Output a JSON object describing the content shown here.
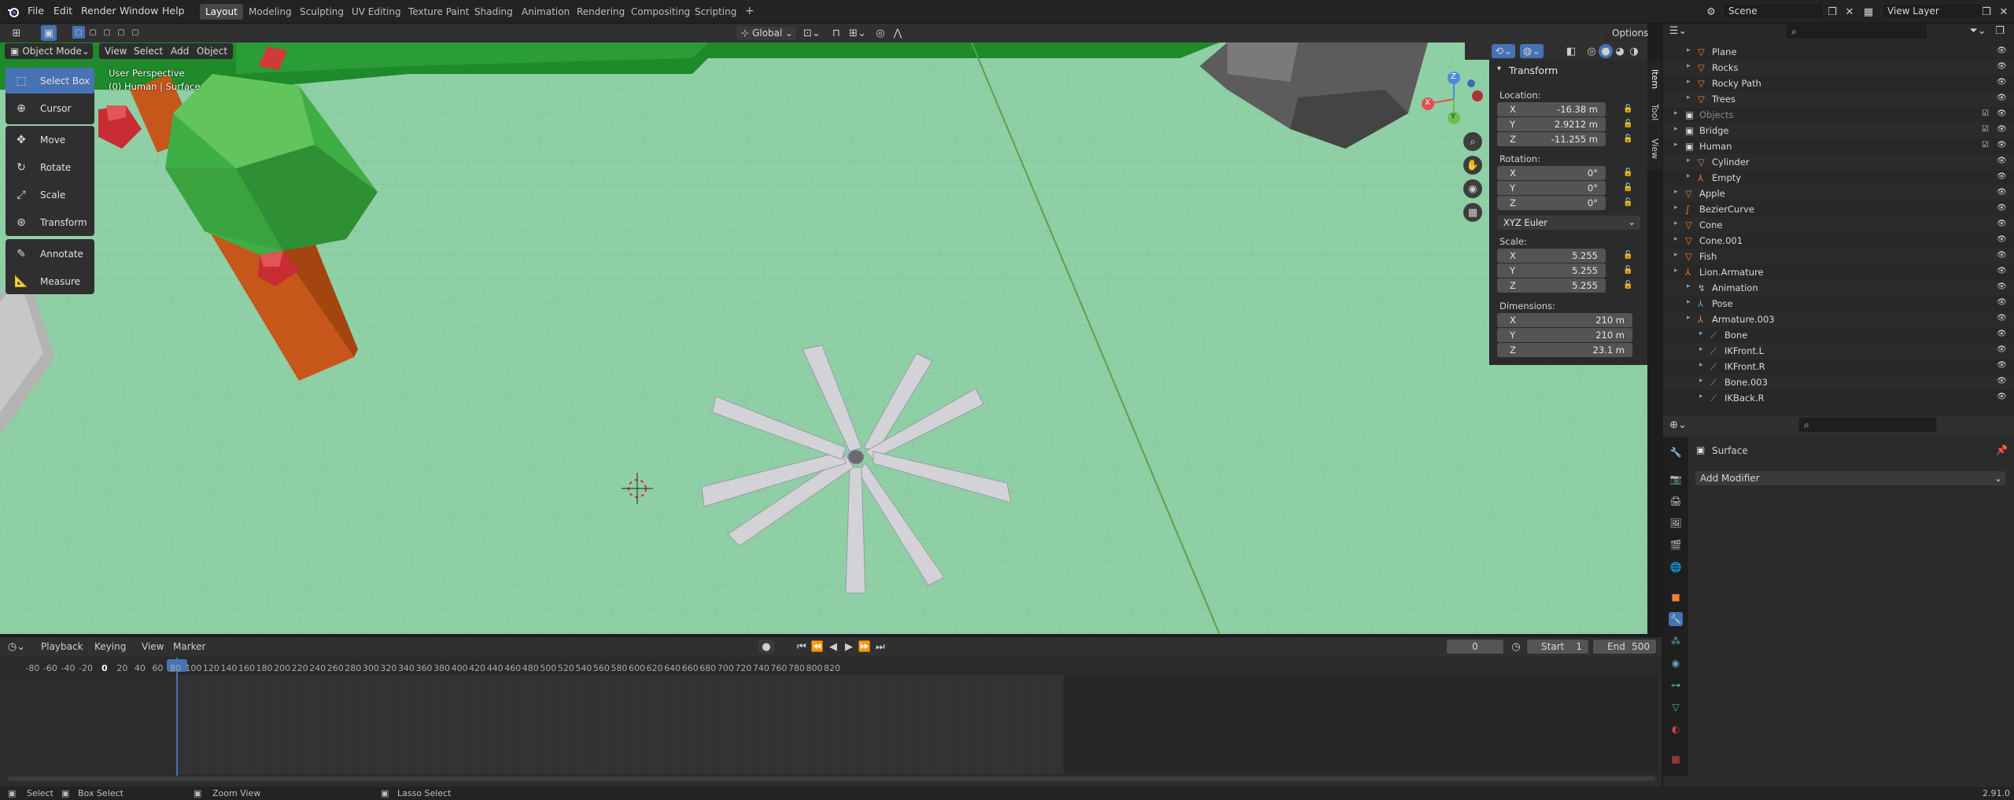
{
  "topbar": {
    "menus": [
      "File",
      "Edit",
      "Render",
      "Window",
      "Help"
    ],
    "workspaces": [
      "Layout",
      "Modeling",
      "Sculpting",
      "UV Editing",
      "Texture Paint",
      "Shading",
      "Animation",
      "Rendering",
      "Compositing",
      "Scripting"
    ],
    "active_workspace": "Layout",
    "add_tab": "+",
    "transform_orientation": "Global",
    "options_label": "Options",
    "scene_name": "Scene",
    "view_layer_name": "View Layer"
  },
  "viewport_header": {
    "mode": "Object Mode",
    "menus": [
      "View",
      "Select",
      "Add",
      "Object"
    ]
  },
  "viewport": {
    "perspective_label": "User Perspective",
    "object_label": "(0) Human | Surface",
    "gizmo_axes": [
      "X",
      "Y",
      "Z"
    ]
  },
  "toolbar": {
    "tools": [
      {
        "label": "Select Box",
        "icon": "select-box-icon",
        "active": true
      },
      {
        "label": "Cursor",
        "icon": "cursor-icon",
        "active": false
      },
      {
        "label": "Move",
        "icon": "move-icon",
        "active": false
      },
      {
        "label": "Rotate",
        "icon": "rotate-icon",
        "active": false
      },
      {
        "label": "Scale",
        "icon": "scale-icon",
        "active": false
      },
      {
        "label": "Transform",
        "icon": "transform-icon",
        "active": false
      },
      {
        "label": "Annotate",
        "icon": "annotate-icon",
        "active": false
      },
      {
        "label": "Measure",
        "icon": "measure-icon",
        "active": false
      }
    ]
  },
  "npanel": {
    "title": "Transform",
    "side_tabs": [
      "Item",
      "Tool",
      "View"
    ],
    "location_label": "Location:",
    "location": [
      {
        "axis": "X",
        "value": "-16.38 m"
      },
      {
        "axis": "Y",
        "value": "2.9212 m"
      },
      {
        "axis": "Z",
        "value": "-11.255 m"
      }
    ],
    "rotation_label": "Rotation:",
    "rotation": [
      {
        "axis": "X",
        "value": "0°"
      },
      {
        "axis": "Y",
        "value": "0°"
      },
      {
        "axis": "Z",
        "value": "0°"
      }
    ],
    "rotation_mode": "XYZ Euler",
    "scale_label": "Scale:",
    "scale": [
      {
        "axis": "X",
        "value": "5.255"
      },
      {
        "axis": "Y",
        "value": "5.255"
      },
      {
        "axis": "Z",
        "value": "5.255"
      }
    ],
    "dimensions_label": "Dimensions:",
    "dimensions": [
      {
        "axis": "X",
        "value": "210 m"
      },
      {
        "axis": "Y",
        "value": "210 m"
      },
      {
        "axis": "Z",
        "value": "23.1 m"
      }
    ]
  },
  "timeline": {
    "menus": [
      "Playback",
      "Keying",
      "View",
      "Marker"
    ],
    "current_frame": "0",
    "start_label": "Start",
    "start": "1",
    "end_label": "End",
    "end": "500",
    "ticks": [
      "-80",
      "-60",
      "-40",
      "-20",
      "0",
      "20",
      "40",
      "60",
      "80",
      "100",
      "120",
      "140",
      "160",
      "180",
      "200",
      "220",
      "240",
      "260",
      "280",
      "300",
      "320",
      "340",
      "360",
      "380",
      "400",
      "420",
      "440",
      "460",
      "480",
      "500",
      "520",
      "540",
      "560",
      "580",
      "600",
      "620",
      "640",
      "660",
      "680",
      "700",
      "720",
      "740",
      "760",
      "780",
      "800",
      "820"
    ]
  },
  "outliner": {
    "items": [
      {
        "name": "Plane",
        "indent": 2,
        "type": "mesh",
        "has_check": false
      },
      {
        "name": "Rocks",
        "indent": 2,
        "type": "mesh",
        "has_check": false
      },
      {
        "name": "Rocky Path",
        "indent": 2,
        "type": "mesh",
        "has_check": false
      },
      {
        "name": "Trees",
        "indent": 2,
        "type": "mesh",
        "has_check": false
      },
      {
        "name": "Objects",
        "indent": 1,
        "type": "collection",
        "has_check": true,
        "dim": true
      },
      {
        "name": "Bridge",
        "indent": 1,
        "type": "collection",
        "has_check": true
      },
      {
        "name": "Human",
        "indent": 1,
        "type": "collection",
        "has_check": true
      },
      {
        "name": "Cylinder",
        "indent": 2,
        "type": "mesh",
        "has_check": false
      },
      {
        "name": "Empty",
        "indent": 2,
        "type": "empty",
        "has_check": false
      },
      {
        "name": "Apple",
        "indent": 1,
        "type": "mesh",
        "has_check": false
      },
      {
        "name": "BezierCurve",
        "indent": 1,
        "type": "curve",
        "has_check": false
      },
      {
        "name": "Cone",
        "indent": 1,
        "type": "mesh",
        "has_check": false
      },
      {
        "name": "Cone.001",
        "indent": 1,
        "type": "mesh",
        "has_check": false
      },
      {
        "name": "Fish",
        "indent": 1,
        "type": "mesh",
        "has_check": false
      },
      {
        "name": "Lion.Armature",
        "indent": 1,
        "type": "armature",
        "has_check": false
      },
      {
        "name": "Animation",
        "indent": 2,
        "type": "anim",
        "has_check": false
      },
      {
        "name": "Pose",
        "indent": 2,
        "type": "pose",
        "has_check": false
      },
      {
        "name": "Armature.003",
        "indent": 2,
        "type": "armature",
        "has_check": false
      },
      {
        "name": "Bone",
        "indent": 3,
        "type": "bone",
        "has_check": false
      },
      {
        "name": "IKFront.L",
        "indent": 3,
        "type": "bone",
        "has_check": false
      },
      {
        "name": "IKFront.R",
        "indent": 3,
        "type": "bone",
        "has_check": false
      },
      {
        "name": "Bone.003",
        "indent": 3,
        "type": "bone",
        "has_check": false
      },
      {
        "name": "IKBack.R",
        "indent": 3,
        "type": "bone",
        "has_check": false
      }
    ]
  },
  "properties": {
    "object_name": "Surface",
    "add_modifier_label": "Add Modifier"
  },
  "statusbar": {
    "select": "Select",
    "box_select": "Box Select",
    "zoom_view": "Zoom View",
    "lasso_select": "Lasso Select",
    "version": "2.91.0"
  },
  "colors": {
    "ground": "#8fcfa6",
    "accent_blue": "#4772b3",
    "mesh_orange": "#e8833a",
    "bone_teal": "#3ec4a8"
  }
}
